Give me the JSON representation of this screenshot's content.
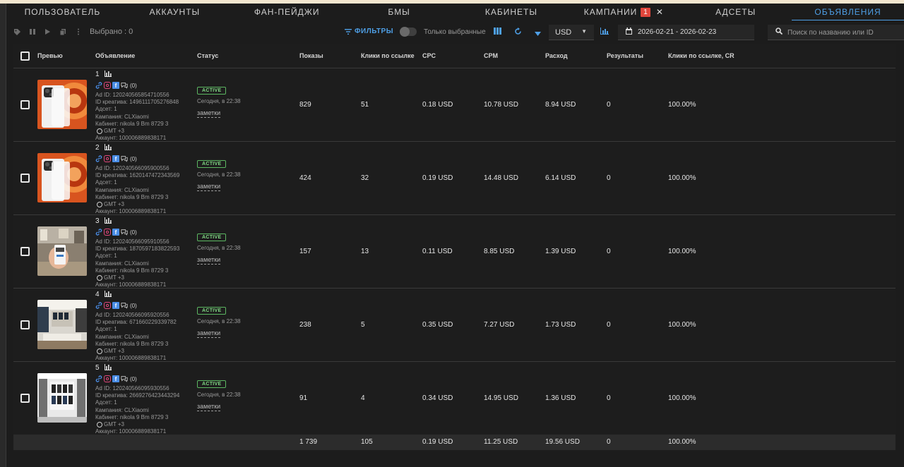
{
  "tabs": [
    {
      "label": "Пользователь"
    },
    {
      "label": "Аккаунты"
    },
    {
      "label": "Фан-пейджи"
    },
    {
      "label": "БМы"
    },
    {
      "label": "Кабинеты"
    },
    {
      "label": "Кампании",
      "badge": "1"
    },
    {
      "label": "Адсеты"
    },
    {
      "label": "Объявления",
      "active": true
    }
  ],
  "toolbar": {
    "selected_label": "Выбрано : 0",
    "filters_label": "ФИЛЬТРЫ",
    "only_selected_label": "Только выбранные",
    "currency": "USD",
    "date_range": "2026-02-21 - 2026-02-23",
    "search_placeholder": "Поиск по названию или ID"
  },
  "table": {
    "headers": {
      "preview": "Превью",
      "ad": "Объявление",
      "status": "Статус",
      "impressions": "Показы",
      "link_clicks": "Клики по ссылке",
      "cpc": "CPC",
      "cpm": "CPM",
      "spend": "Расход",
      "results": "Результаты",
      "link_clicks_cr": "Клики по ссылке, CR"
    },
    "rows": [
      {
        "num": "1",
        "comments": "(0)",
        "ad_id": "Ad ID: 120240565854710556",
        "creative_id": "ID креатива: 1496111705276848",
        "adset": "Адсет: 1",
        "campaign": "Кампания: CLXiaomi",
        "cabinet": "Кабинет: nikola 9 Bm 8729 3",
        "gmt": "GMT +3",
        "account": "Аккаунт: 100006889838171",
        "status": "ACTIVE",
        "updated": "Сегодня, в 22:38",
        "notes": "заметки",
        "impressions": "829",
        "link_clicks": "51",
        "cpc": "0.18 USD",
        "cpm": "10.78 USD",
        "spend": "8.94 USD",
        "results": "0",
        "cr": "100.00%",
        "thumb": "phone"
      },
      {
        "num": "2",
        "comments": "(0)",
        "ad_id": "Ad ID: 120240566095900556",
        "creative_id": "ID креатива: 1620147472343569",
        "adset": "Адсет: 1",
        "campaign": "Кампания: CLXiaomi",
        "cabinet": "Кабинет: nikola 9 Bm 8729 3",
        "gmt": "GMT +3",
        "account": "Аккаунт: 100006889838171",
        "status": "ACTIVE",
        "updated": "Сегодня, в 22:38",
        "notes": "заметки",
        "impressions": "424",
        "link_clicks": "32",
        "cpc": "0.19 USD",
        "cpm": "14.48 USD",
        "spend": "6.14 USD",
        "results": "0",
        "cr": "100.00%",
        "thumb": "phone"
      },
      {
        "num": "3",
        "comments": "(0)",
        "ad_id": "Ad ID: 120240566095910556",
        "creative_id": "ID креатива: 1870597183822593",
        "adset": "Адсет: 1",
        "campaign": "Кампания: CLXiaomi",
        "cabinet": "Кабинет: nikola 9 Bm 8729 3",
        "gmt": "GMT +3",
        "account": "Аккаунт: 100006889838171",
        "status": "ACTIVE",
        "updated": "Сегодня, в 22:38",
        "notes": "заметки",
        "impressions": "157",
        "link_clicks": "13",
        "cpc": "0.11 USD",
        "cpm": "8.85 USD",
        "spend": "1.39 USD",
        "results": "0",
        "cr": "100.00%",
        "thumb": "hand"
      },
      {
        "num": "4",
        "comments": "(0)",
        "ad_id": "Ad ID: 120240566095920556",
        "creative_id": "ID креатива: 671660229339782",
        "adset": "Адсет: 1",
        "campaign": "Кампания: CLXiaomi",
        "cabinet": "Кабинет: nikola 9 Bm 8729 3",
        "gmt": "GMT +3",
        "account": "Аккаунт: 100006889838171",
        "status": "ACTIVE",
        "updated": "Сегодня, в 22:38",
        "notes": "заметки",
        "impressions": "238",
        "link_clicks": "5",
        "cpc": "0.35 USD",
        "cpm": "7.27 USD",
        "spend": "1.73 USD",
        "results": "0",
        "cr": "100.00%",
        "thumb": "store"
      },
      {
        "num": "5",
        "comments": "(0)",
        "ad_id": "Ad ID: 120240566095930556",
        "creative_id": "ID креатива: 2669276423443294",
        "adset": "Адсет: 1",
        "campaign": "Кампания: CLXiaomi",
        "cabinet": "Кабинет: nikola 9 Bm 8729 3",
        "gmt": "GMT +3",
        "account": "Аккаунт: 100006889838171",
        "status": "ACTIVE",
        "updated": "Сегодня, в 22:38",
        "notes": "заметки",
        "impressions": "91",
        "link_clicks": "4",
        "cpc": "0.34 USD",
        "cpm": "14.95 USD",
        "spend": "1.36 USD",
        "results": "0",
        "cr": "100.00%",
        "thumb": "shelves"
      }
    ],
    "totals": {
      "impressions": "1 739",
      "link_clicks": "105",
      "cpc": "0.19 USD",
      "cpm": "11.25 USD",
      "spend": "19.56 USD",
      "results": "0",
      "cr": "100.00%"
    }
  },
  "colors": {
    "accent": "#4e9fe6",
    "active_status": "#5cb661",
    "badge": "#e0463c",
    "background": "#1c1c1c"
  }
}
